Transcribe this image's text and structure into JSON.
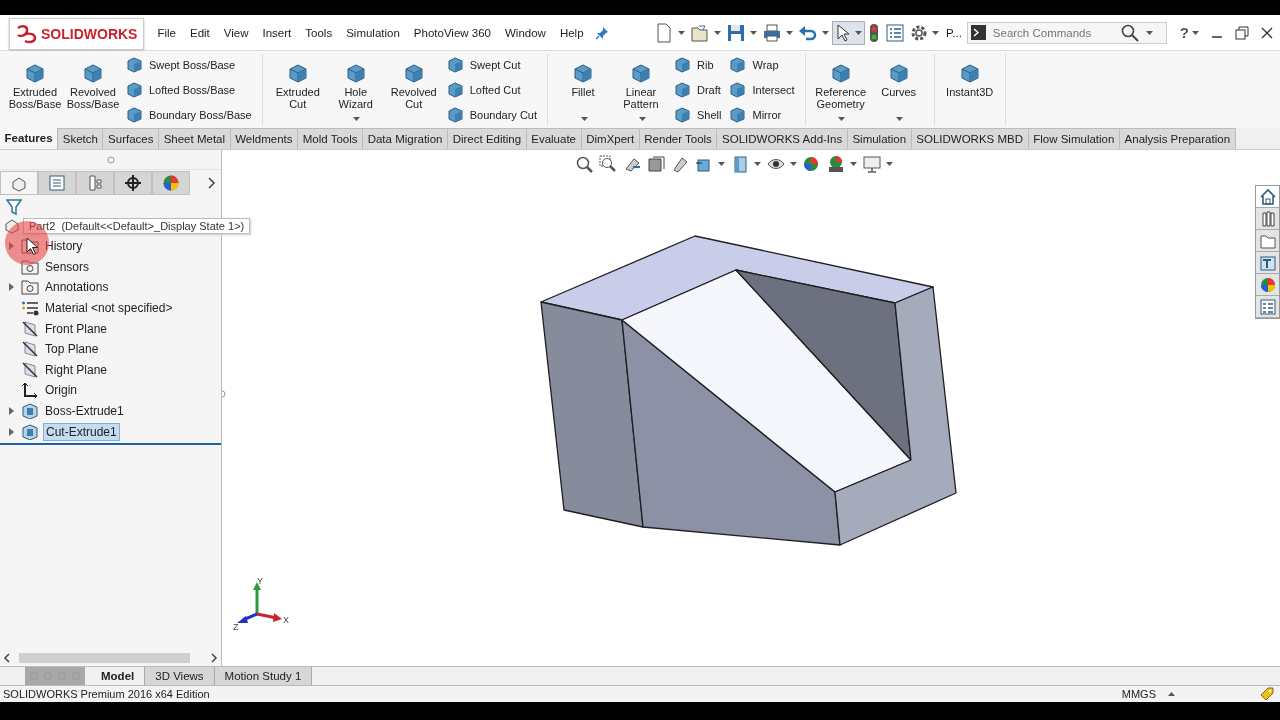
{
  "app": {
    "logo": "SOLIDWORKS"
  },
  "menu": [
    {
      "label": "File"
    },
    {
      "label": "Edit"
    },
    {
      "label": "View"
    },
    {
      "label": "Insert"
    },
    {
      "label": "Tools"
    },
    {
      "label": "Simulation"
    },
    {
      "label": "PhotoView 360"
    },
    {
      "label": "Window"
    },
    {
      "label": "Help"
    }
  ],
  "quick_access": {
    "truncated_label": "P...",
    "help_button": "?"
  },
  "search": {
    "placeholder": "Search Commands"
  },
  "ribbon": {
    "groups": [
      {
        "items": [
          {
            "kind": "large",
            "label": "Extruded Boss/Base",
            "dropdown": false
          },
          {
            "kind": "large",
            "label": "Revolved Boss/Base",
            "dropdown": false
          },
          {
            "kind": "stack",
            "labels": [
              "Swept Boss/Base",
              "Lofted Boss/Base",
              "Boundary Boss/Base"
            ]
          }
        ]
      },
      {
        "items": [
          {
            "kind": "large",
            "label": "Extruded Cut",
            "dropdown": false
          },
          {
            "kind": "large",
            "label": "Hole Wizard",
            "dropdown": true
          },
          {
            "kind": "large",
            "label": "Revolved Cut",
            "dropdown": false
          },
          {
            "kind": "stack",
            "labels": [
              "Swept Cut",
              "Lofted Cut",
              "Boundary Cut"
            ]
          }
        ]
      },
      {
        "items": [
          {
            "kind": "large",
            "label": "Fillet",
            "dropdown": true
          },
          {
            "kind": "large",
            "label": "Linear Pattern",
            "dropdown": true
          },
          {
            "kind": "stack",
            "labels": [
              "Rib",
              "Draft",
              "Shell"
            ]
          },
          {
            "kind": "stack",
            "labels": [
              "Wrap",
              "Intersect",
              "Mirror"
            ]
          }
        ]
      },
      {
        "items": [
          {
            "kind": "large",
            "label": "Reference Geometry",
            "dropdown": true
          },
          {
            "kind": "large",
            "label": "Curves",
            "dropdown": true
          }
        ]
      },
      {
        "items": [
          {
            "kind": "large",
            "label": "Instant3D",
            "dropdown": false
          }
        ]
      }
    ]
  },
  "command_tabs": [
    {
      "label": "Features",
      "selected": true
    },
    {
      "label": "Sketch",
      "selected": false
    },
    {
      "label": "Surfaces",
      "selected": false
    },
    {
      "label": "Sheet Metal",
      "selected": false
    },
    {
      "label": "Weldments",
      "selected": false
    },
    {
      "label": "Mold Tools",
      "selected": false
    },
    {
      "label": "Data Migration",
      "selected": false
    },
    {
      "label": "Direct Editing",
      "selected": false
    },
    {
      "label": "Evaluate",
      "selected": false
    },
    {
      "label": "DimXpert",
      "selected": false
    },
    {
      "label": "Render Tools",
      "selected": false
    },
    {
      "label": "SOLIDWORKS Add-Ins",
      "selected": false
    },
    {
      "label": "Simulation",
      "selected": false
    },
    {
      "label": "SOLIDWORKS MBD",
      "selected": false
    },
    {
      "label": "Flow Simulation",
      "selected": false
    },
    {
      "label": "Analysis Preparation",
      "selected": false
    }
  ],
  "panel_tabs": [
    {
      "selected": true
    },
    {
      "selected": false
    },
    {
      "selected": false
    },
    {
      "selected": false
    },
    {
      "selected": false
    }
  ],
  "task_pane": [
    {
      "selected": true
    },
    {
      "selected": false
    },
    {
      "selected": false
    },
    {
      "selected": false
    },
    {
      "selected": false
    },
    {
      "selected": false
    }
  ],
  "feature_tree": {
    "root": {
      "label": "Part2",
      "config": "(Default<<Default>_Display State 1>)",
      "children": [
        {
          "kind": "folder",
          "label": "History",
          "collapsed": true,
          "selected": false
        },
        {
          "kind": "folder",
          "label": "Sensors",
          "collapsed": false,
          "selected": false
        },
        {
          "kind": "folder",
          "label": "Annotations",
          "collapsed": true,
          "selected": false
        },
        {
          "kind": "material",
          "label": "Material <not specified>",
          "collapsed": false,
          "selected": false
        },
        {
          "kind": "plane",
          "label": "Front Plane",
          "collapsed": false,
          "selected": false
        },
        {
          "kind": "plane",
          "label": "Top Plane",
          "collapsed": false,
          "selected": false
        },
        {
          "kind": "plane",
          "label": "Right Plane",
          "collapsed": false,
          "selected": false
        },
        {
          "kind": "origin",
          "label": "Origin",
          "collapsed": false,
          "selected": false
        },
        {
          "kind": "feature",
          "label": "Boss-Extrude1",
          "collapsed": true,
          "selected": false
        },
        {
          "kind": "feature",
          "label": "Cut-Extrude1",
          "collapsed": true,
          "selected": true
        }
      ]
    }
  },
  "triad": {
    "x_label": "X",
    "y_label": "Y",
    "z_label": "Z"
  },
  "bottom_tabs": [
    {
      "label": "Model",
      "selected": true
    },
    {
      "label": "3D Views",
      "selected": false
    },
    {
      "label": "Motion Study 1",
      "selected": false
    }
  ],
  "status_bar": {
    "edition": "SOLIDWORKS Premium 2016 x64 Edition",
    "units": "MMGS"
  }
}
